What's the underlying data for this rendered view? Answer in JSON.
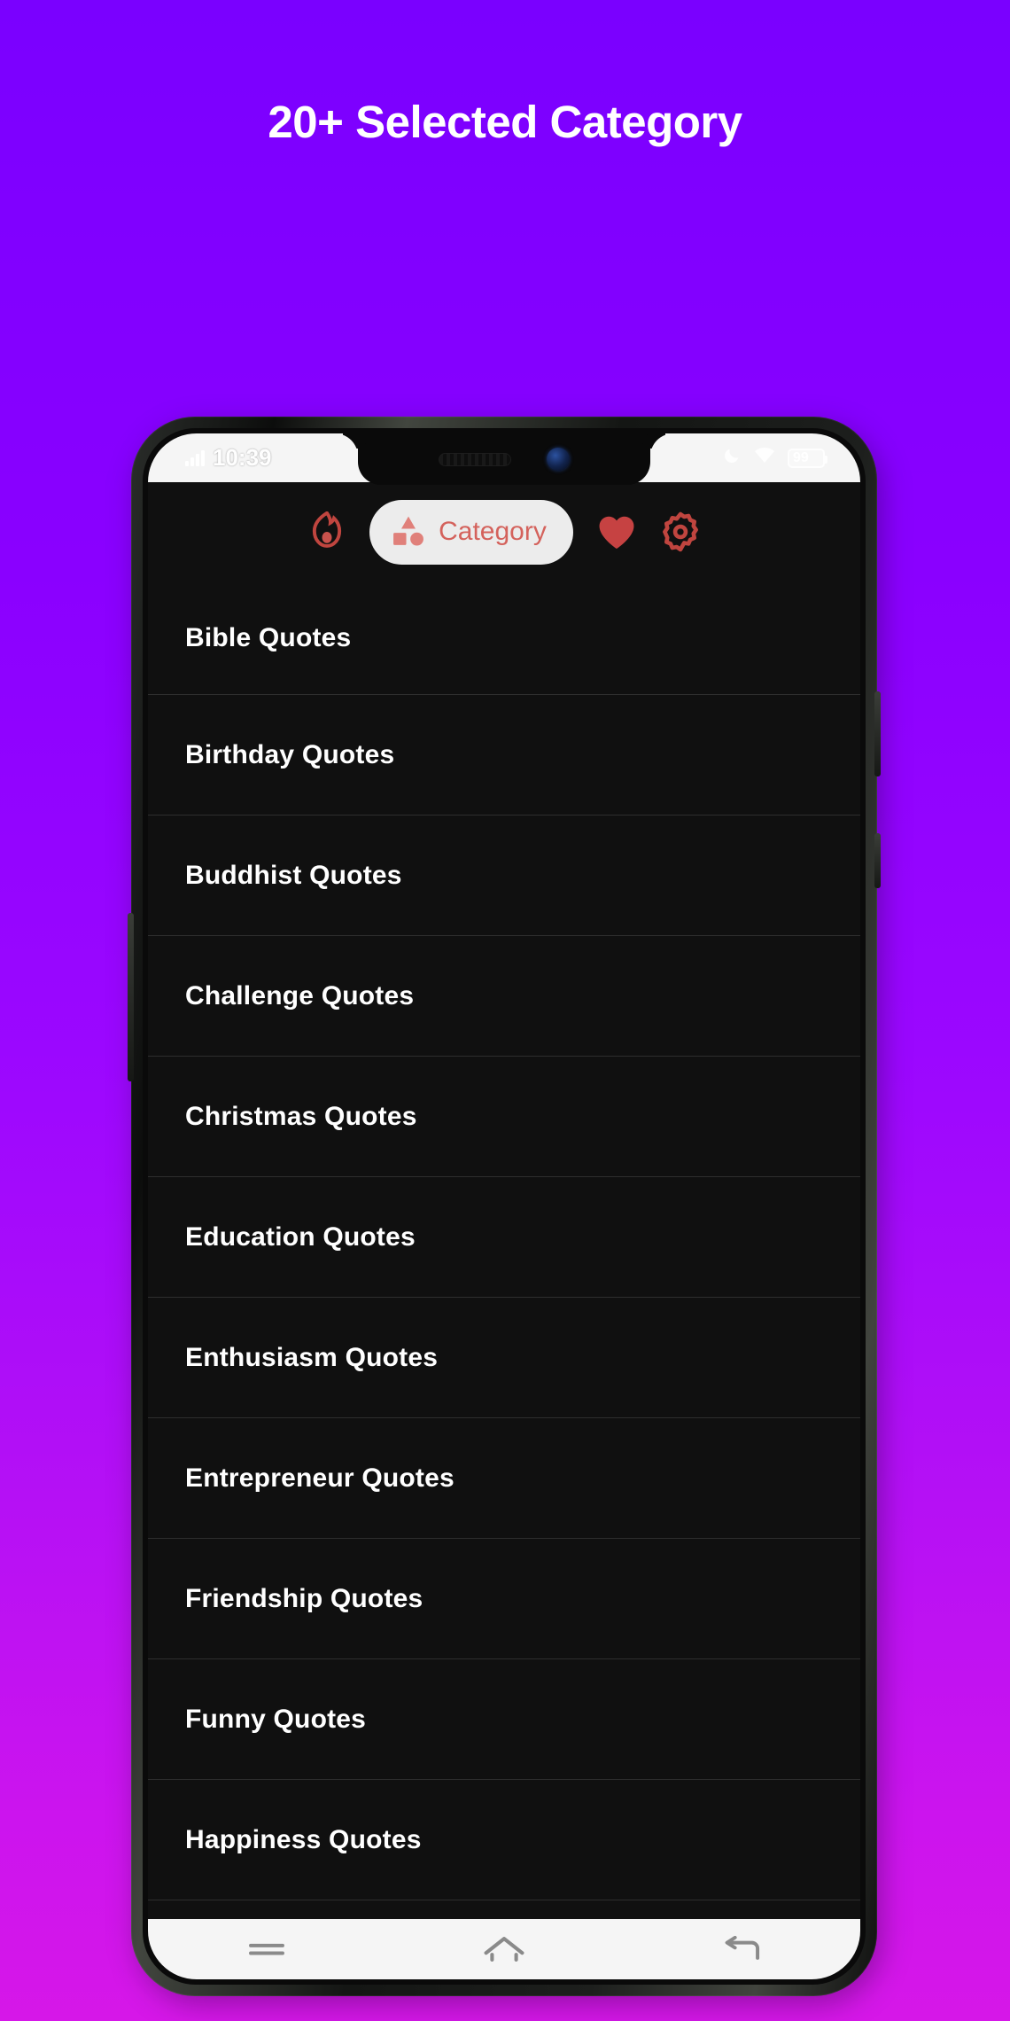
{
  "headline": "20+ Selected Category",
  "theme": {
    "bg_gradient_top": "#7a00ff",
    "bg_gradient_bottom": "#d617e8",
    "app_background": "#101010",
    "accent": "#d4625c",
    "heart_color": "#c64242",
    "text_color": "#ffffff"
  },
  "phone": {
    "status_bar": {
      "time": "10:39",
      "signal_icon": "signal-bars-icon",
      "moon_icon": "do-not-disturb-moon-icon",
      "wifi_icon": "wifi-icon",
      "battery_level": "99",
      "battery_icon": "battery-icon"
    },
    "notch": {
      "speaker_icon": "earpiece-speaker-icon",
      "camera_icon": "front-camera-icon"
    },
    "navbar": {
      "recents_label": "recents-icon",
      "home_label": "home-icon",
      "back_label": "back-icon"
    }
  },
  "toolbar": {
    "flame_label": "flame-icon",
    "category_pill": {
      "icon": "shapes-icon",
      "label": "Category"
    },
    "favorites_label": "heart-icon",
    "settings_label": "gear-icon"
  },
  "categories": [
    {
      "label": "Bible Quotes"
    },
    {
      "label": "Birthday Quotes"
    },
    {
      "label": "Buddhist Quotes"
    },
    {
      "label": "Challenge Quotes"
    },
    {
      "label": "Christmas Quotes"
    },
    {
      "label": "Education Quotes"
    },
    {
      "label": "Enthusiasm Quotes"
    },
    {
      "label": "Entrepreneur Quotes"
    },
    {
      "label": "Friendship Quotes"
    },
    {
      "label": "Funny Quotes"
    },
    {
      "label": "Happiness Quotes"
    }
  ]
}
